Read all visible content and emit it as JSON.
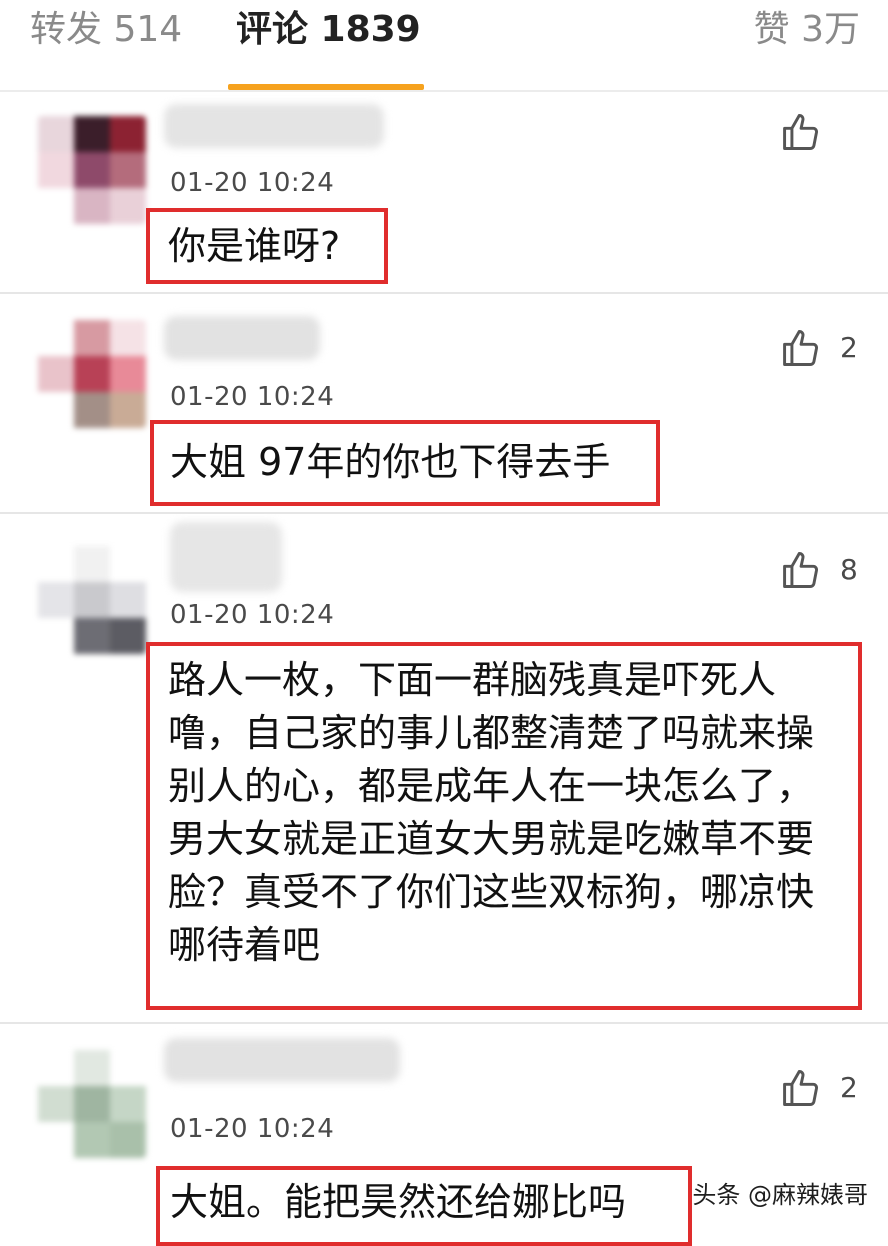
{
  "tabs": {
    "repost": "转发 514",
    "comment": "评论 1839",
    "like": "赞 3万"
  },
  "comments": [
    {
      "time": "01-20 10:24",
      "likes": "",
      "text": "你是谁呀?"
    },
    {
      "time": "01-20 10:24",
      "likes": "2",
      "text": "大姐 97年的你也下得去手"
    },
    {
      "time": "01-20 10:24",
      "likes": "8",
      "text": "路人一枚，下面一群脑残真是吓死人噜，自己家的事儿都整清楚了吗就来操别人的心，都是成年人在一块怎么了，男大女就是正道女大男就是吃嫩草不要脸？真受不了你们这些双标狗，哪凉快哪待着吧"
    },
    {
      "time": "01-20 10:24",
      "likes": "2",
      "text": "大姐。能把昊然还给娜比吗"
    }
  ],
  "watermark": "头条 @麻辣婊哥",
  "colors": {
    "accent": "#f6a21e",
    "highlight_border": "#e02d2d"
  }
}
